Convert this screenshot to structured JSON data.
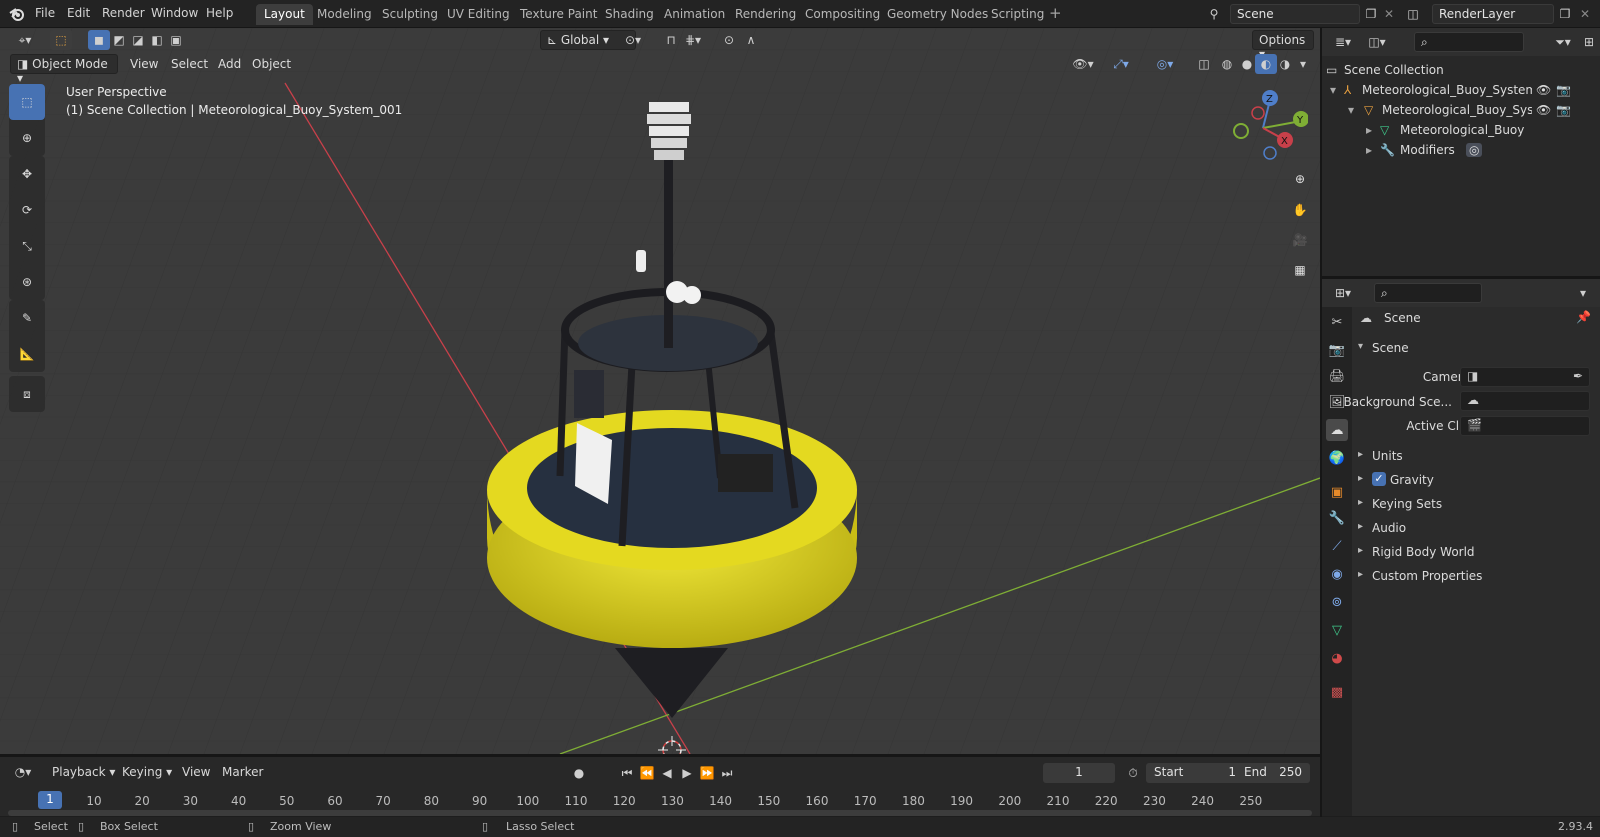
{
  "topbar": {
    "menus": [
      "File",
      "Edit",
      "Render",
      "Window",
      "Help"
    ],
    "workspaces": [
      "Layout",
      "Modeling",
      "Sculpting",
      "UV Editing",
      "Texture Paint",
      "Shading",
      "Animation",
      "Rendering",
      "Compositing",
      "Geometry Nodes",
      "Scripting"
    ],
    "active_workspace": "Layout",
    "scene_name": "Scene",
    "view_layer": "RenderLayer"
  },
  "viewport": {
    "mode": "Object Mode",
    "menus": [
      "View",
      "Select",
      "Add",
      "Object"
    ],
    "transform_orientation": "Global",
    "options_label": "Options",
    "perspective_label": "User Perspective",
    "collection_path": "(1) Scene Collection | Meteorological_Buoy_System_001",
    "gizmo_axes": {
      "x": "X",
      "y": "Y",
      "z": "Z"
    },
    "colors": {
      "x_axis": "#c8404a",
      "y_axis": "#7fae35",
      "grid_bg": "#3b3b3b",
      "buoy_yellow": "#e6dc1c",
      "active_tool": "#4772b3"
    }
  },
  "timeline": {
    "menus": [
      "Playback",
      "Keying",
      "View",
      "Marker"
    ],
    "current_frame": "1",
    "start_label": "Start",
    "start_value": "1",
    "end_label": "End",
    "end_value": "250",
    "ruler_current": "1",
    "ruler_ticks": [
      "10",
      "20",
      "30",
      "40",
      "50",
      "60",
      "70",
      "80",
      "90",
      "100",
      "110",
      "120",
      "130",
      "140",
      "150",
      "160",
      "170",
      "180",
      "190",
      "200",
      "210",
      "220",
      "230",
      "240",
      "250"
    ]
  },
  "statusbar": {
    "select": "Select",
    "box_select": "Box Select",
    "zoom_view": "Zoom View",
    "lasso_select": "Lasso Select",
    "version": "2.93.4"
  },
  "outliner": {
    "rows": [
      {
        "label": "Scene Collection"
      },
      {
        "label": "Meteorological_Buoy_System"
      },
      {
        "label": "Meteorological_Buoy_Sys"
      },
      {
        "label": "Meteorological_Buoy"
      },
      {
        "label": "Modifiers"
      }
    ]
  },
  "properties": {
    "context": "Scene",
    "panel_title": "Scene",
    "fields": [
      {
        "label": "Camera"
      },
      {
        "label": "Background Sce..."
      },
      {
        "label": "Active Clip"
      }
    ],
    "panels": [
      "Units",
      "Gravity",
      "Keying Sets",
      "Audio",
      "Rigid Body World",
      "Custom Properties"
    ],
    "gravity_checked": true
  }
}
